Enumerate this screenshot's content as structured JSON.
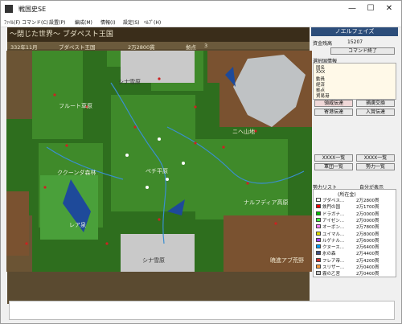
{
  "app_title": "戦国史SE",
  "window_controls": {
    "minimize": "—",
    "maximize": "☐",
    "close": "✕"
  },
  "menubar": [
    "ﾌｧｲﾙ(F)",
    "コマンド(C)",
    "設置(P)",
    "編成(M)",
    "情報(I)",
    "設定(S)",
    "ﾍﾙﾌﾟ(H)"
  ],
  "header": {
    "scenario": "～閉じた世界～ ブダペスト王国",
    "date": "332年11月",
    "nation": "ブダペスト王国",
    "money": "2万2800貫",
    "base_label": "拠点",
    "base_count": "3"
  },
  "map": {
    "regions": [
      {
        "name": "シナ雪原",
        "pos": "top"
      },
      {
        "name": "フルート草原",
        "pos": "upper-left"
      },
      {
        "name": "ニヘ山地",
        "pos": "upper-right"
      },
      {
        "name": "ククーンダ森林",
        "pos": "middle-left"
      },
      {
        "name": "ペチ平原",
        "pos": "center"
      },
      {
        "name": "ナルフディア高原",
        "pos": "middle-right"
      },
      {
        "name": "レア泉",
        "pos": "lower-left"
      },
      {
        "name": "シナ雪原",
        "pos": "bottom"
      },
      {
        "name": "暁進アブ荒野",
        "pos": "bottom-right"
      }
    ]
  },
  "panel": {
    "title": "ノエルフェイズ",
    "funds_label": "資金残高",
    "funds_value": "15207",
    "end_command": "コマンド終了",
    "info_title": "選択国情報",
    "info_lines": [
      "国名",
      "XXX",
      "動員",
      "経済",
      "拠点",
      "貿易港"
    ],
    "btn_special": "領威伝達",
    "btn_exchange": "捕虜交換",
    "btn_sale": "寄港伝達",
    "btn_join": "入賞伝達",
    "btn_list1a": "XXXX一覧",
    "btn_list1b": "XXXX一覧",
    "btn_list2a": "軍団一覧",
    "btn_list2b": "勢力一覧",
    "force_list_label": "勢力リスト",
    "self_toggle": "自分が表示",
    "list_header": "(所在金)",
    "forces": [
      {
        "name": "ブダペス...",
        "money": "2万2800貫",
        "color": "#ffffff"
      },
      {
        "name": "鉄門の国",
        "money": "2万1700貫",
        "color": "#ff0000"
      },
      {
        "name": "ドラガナ...",
        "money": "2万0000貫",
        "color": "#00c000"
      },
      {
        "name": "アイゼン...",
        "money": "2万0000貫",
        "color": "#40ff40"
      },
      {
        "name": "オーボン...",
        "money": "2万7800貫",
        "color": "#ff80ff"
      },
      {
        "name": "ユイマル...",
        "money": "2万8000貫",
        "color": "#e0e000"
      },
      {
        "name": "ルゲナル...",
        "money": "2万6000貫",
        "color": "#a040ff"
      },
      {
        "name": "クヌース...",
        "money": "2万6400貫",
        "color": "#00a0ff"
      },
      {
        "name": "氷の森",
        "money": "2万4400貫",
        "color": "#405080"
      },
      {
        "name": "フレア帝...",
        "money": "2万4200貫",
        "color": "#d03030"
      },
      {
        "name": "スリザー...",
        "money": "2万0400貫",
        "color": "#ffa040"
      },
      {
        "name": "霧の乙宮",
        "money": "2万0400貫",
        "color": "#c0c0c0"
      }
    ]
  }
}
